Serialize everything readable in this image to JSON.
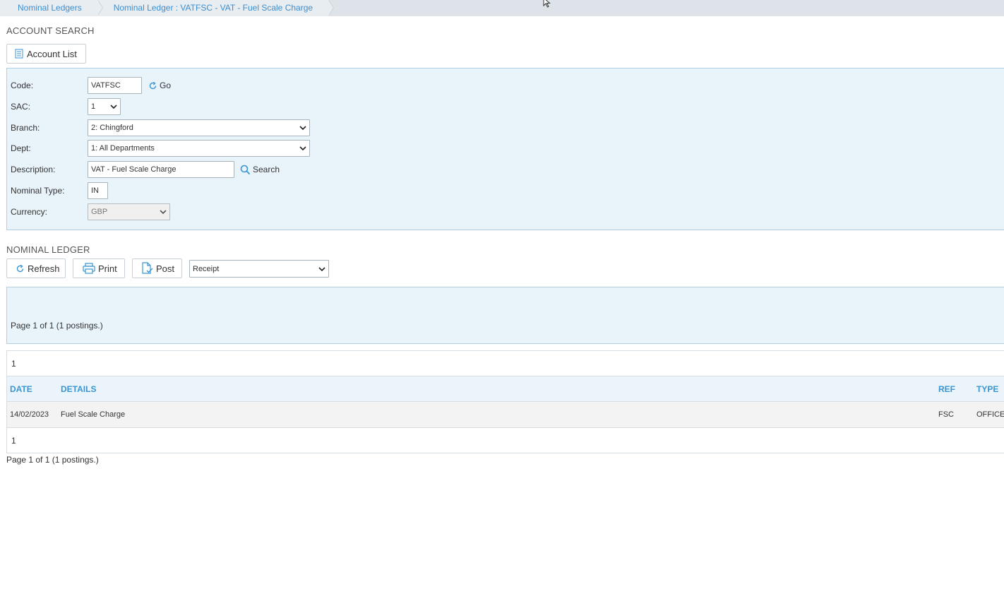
{
  "breadcrumb": {
    "items": [
      {
        "label": "Nominal Ledgers"
      },
      {
        "label": "Nominal Ledger : VATFSC - VAT - Fuel Scale Charge"
      }
    ]
  },
  "account_search": {
    "title": "ACCOUNT SEARCH",
    "account_list_label": "Account List",
    "form": {
      "code_label": "Code:",
      "code_value": "VATFSC",
      "go_label": "Go",
      "sac_label": "SAC:",
      "sac_value": "1",
      "branch_label": "Branch:",
      "branch_value": "2: Chingford",
      "dept_label": "Dept:",
      "dept_value": "1: All Departments",
      "description_label": "Description:",
      "description_value": "VAT - Fuel Scale Charge",
      "search_label": "Search",
      "nominal_type_label": "Nominal Type:",
      "nominal_type_value": "IN",
      "currency_label": "Currency:",
      "currency_value": "GBP"
    }
  },
  "nominal_ledger": {
    "title": "NOMINAL LEDGER",
    "toolbar": {
      "refresh_label": "Refresh",
      "print_label": "Print",
      "post_label": "Post",
      "post_type_value": "Receipt"
    },
    "summary": "Page 1 of 1 (1 postings.)",
    "top_pager": "1",
    "columns": {
      "date": "DATE",
      "details": "DETAILS",
      "ref": "REF",
      "type": "TYPE"
    },
    "rows": [
      {
        "date": "14/02/2023",
        "details": "Fuel Scale Charge",
        "ref": "FSC",
        "type": "OFFICE"
      }
    ],
    "bottom_pager": "1",
    "footer_summary": "Page 1 of 1 (1 postings.)"
  },
  "colors": {
    "accent": "#3a95d1",
    "panel_bg": "#e8f3fa",
    "panel_border": "#aecfe6",
    "breadcrumb_bg": "#dde3e9"
  }
}
